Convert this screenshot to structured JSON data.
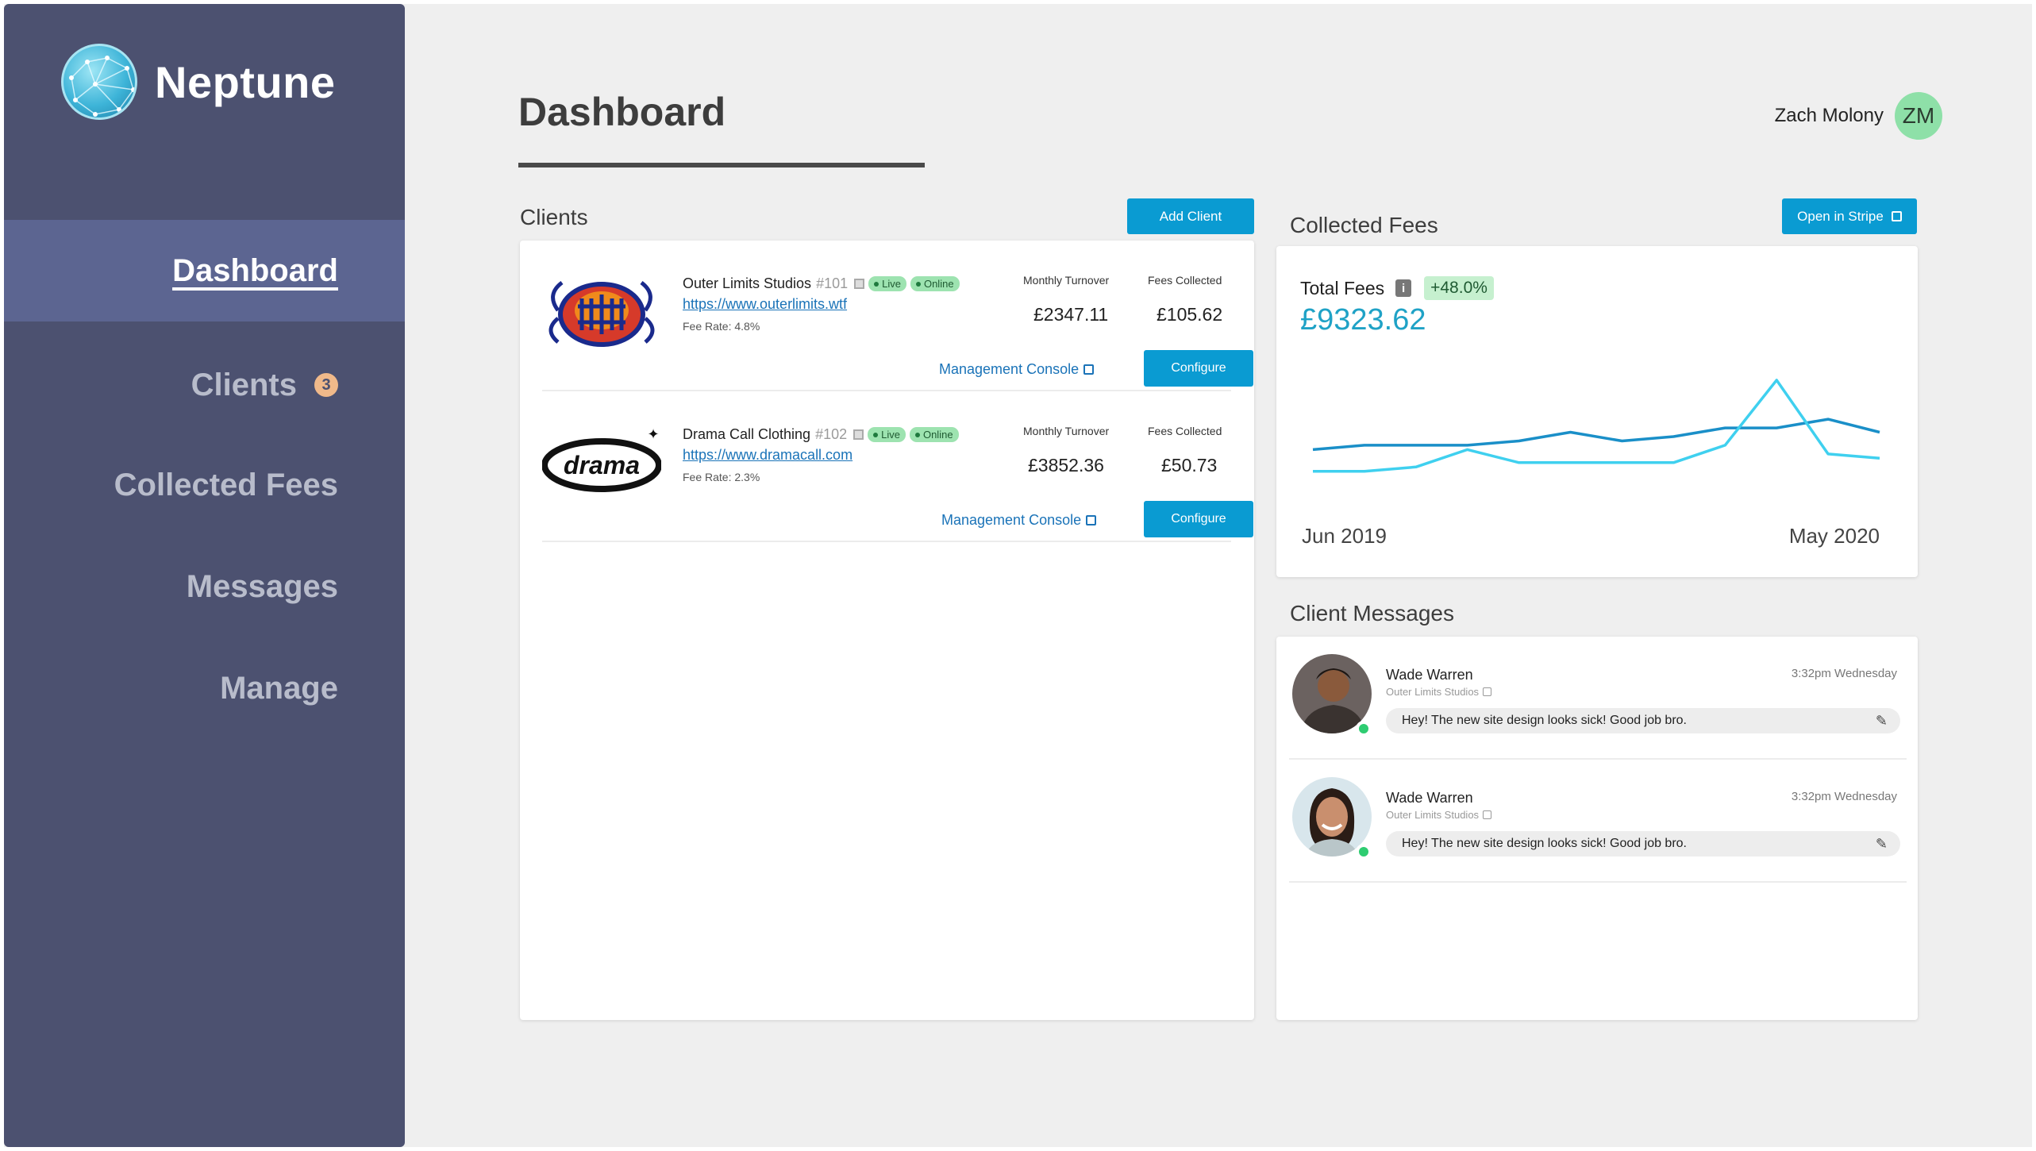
{
  "app": {
    "name": "Neptune"
  },
  "sidebar": {
    "items": [
      {
        "label": "Dashboard",
        "active": true
      },
      {
        "label": "Clients",
        "badge": "3"
      },
      {
        "label": "Collected Fees"
      },
      {
        "label": "Messages"
      },
      {
        "label": "Manage"
      }
    ]
  },
  "header": {
    "title": "Dashboard",
    "user_name": "Zach Molony",
    "user_initials": "ZM"
  },
  "clients": {
    "title": "Clients",
    "add_label": "Add Client",
    "rows": [
      {
        "name": "Outer Limits Studios",
        "id": "#101",
        "status_live": "Live",
        "status_online": "Online",
        "url": "https://www.outerlimits.wtf",
        "fee_rate": "Fee Rate: 4.8%",
        "turnover_label": "Monthly Turnover",
        "turnover": "£2347.11",
        "fees_label": "Fees Collected",
        "fees": "£105.62",
        "console_label": "Management Console",
        "configure_label": "Configure"
      },
      {
        "name": "Drama Call Clothing",
        "id": "#102",
        "status_live": "Live",
        "status_online": "Online",
        "url": "https://www.dramacall.com",
        "fee_rate": "Fee Rate: 2.3%",
        "turnover_label": "Monthly Turnover",
        "turnover": "£3852.36",
        "fees_label": "Fees Collected",
        "fees": "£50.73",
        "console_label": "Management Console",
        "configure_label": "Configure",
        "logo_text": "drama"
      }
    ]
  },
  "fees": {
    "title": "Collected Fees",
    "stripe_label": "Open in Stripe",
    "total_label": "Total Fees",
    "info_icon": "i",
    "change": "+48.0%",
    "total": "£9323.62",
    "x_start": "Jun 2019",
    "x_end": "May 2020"
  },
  "chart_data": {
    "type": "line",
    "x": [
      "Jun 2019",
      "",
      "",
      "",
      "",
      "",
      "",
      "",
      "",
      "",
      "",
      "May 2020"
    ],
    "series": [
      {
        "values": [
          22,
          23,
          23,
          23,
          24,
          26,
          24,
          25,
          27,
          27,
          29,
          26
        ]
      },
      {
        "values": [
          17,
          17,
          18,
          22,
          19,
          19,
          19,
          19,
          23,
          38,
          21,
          20
        ]
      }
    ],
    "colors": [
      "#1a8fc8",
      "#3fd0ef"
    ],
    "grid": false
  },
  "messages": {
    "title": "Client Messages",
    "items": [
      {
        "name": "Wade Warren",
        "company": "Outer Limits Studios",
        "time": "3:32pm Wednesday",
        "text": "Hey! The new site design looks sick! Good job bro."
      },
      {
        "name": "Wade Warren",
        "company": "Outer Limits Studios",
        "time": "3:32pm Wednesday",
        "text": "Hey! The new site design looks sick! Good job bro."
      }
    ]
  }
}
